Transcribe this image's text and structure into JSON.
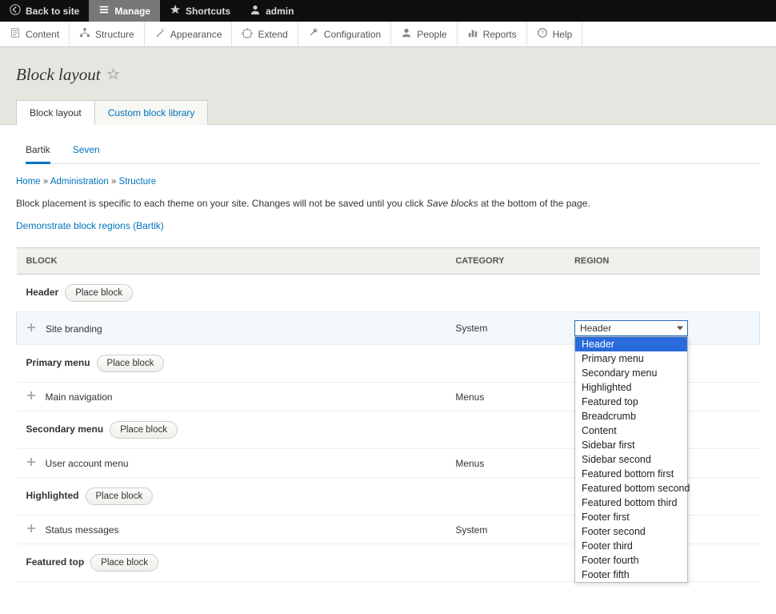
{
  "toolbar": {
    "back": "Back to site",
    "manage": "Manage",
    "shortcuts": "Shortcuts",
    "user": "admin"
  },
  "admin_menu": [
    {
      "id": "content",
      "label": "Content"
    },
    {
      "id": "structure",
      "label": "Structure"
    },
    {
      "id": "appearance",
      "label": "Appearance"
    },
    {
      "id": "extend",
      "label": "Extend"
    },
    {
      "id": "configuration",
      "label": "Configuration"
    },
    {
      "id": "people",
      "label": "People"
    },
    {
      "id": "reports",
      "label": "Reports"
    },
    {
      "id": "help",
      "label": "Help"
    }
  ],
  "page_title": "Block layout",
  "primary_tabs": {
    "block_layout": "Block layout",
    "custom_lib": "Custom block library"
  },
  "theme_tabs": {
    "bartik": "Bartik",
    "seven": "Seven"
  },
  "breadcrumb": {
    "home": "Home",
    "admin": "Administration",
    "structure": "Structure"
  },
  "description": {
    "pre": "Block placement is specific to each theme on your site. Changes will not be saved until you click ",
    "em": "Save blocks",
    "post": " at the bottom of the page."
  },
  "demo_link": "Demonstrate block regions (Bartik)",
  "table_headers": {
    "block": "BLOCK",
    "category": "CATEGORY",
    "region": "REGION"
  },
  "place_block_label": "Place block",
  "regions": [
    {
      "name": "Header",
      "blocks": [
        {
          "name": "Site branding",
          "category": "System",
          "selected_region": "Header",
          "open_dropdown": true
        }
      ]
    },
    {
      "name": "Primary menu",
      "blocks": [
        {
          "name": "Main navigation",
          "category": "Menus"
        }
      ]
    },
    {
      "name": "Secondary menu",
      "blocks": [
        {
          "name": "User account menu",
          "category": "Menus"
        }
      ]
    },
    {
      "name": "Highlighted",
      "blocks": [
        {
          "name": "Status messages",
          "category": "System"
        }
      ]
    },
    {
      "name": "Featured top",
      "blocks": []
    }
  ],
  "region_options": [
    "Header",
    "Primary menu",
    "Secondary menu",
    "Highlighted",
    "Featured top",
    "Breadcrumb",
    "Content",
    "Sidebar first",
    "Sidebar second",
    "Featured bottom first",
    "Featured bottom second",
    "Featured bottom third",
    "Footer first",
    "Footer second",
    "Footer third",
    "Footer fourth",
    "Footer fifth"
  ]
}
